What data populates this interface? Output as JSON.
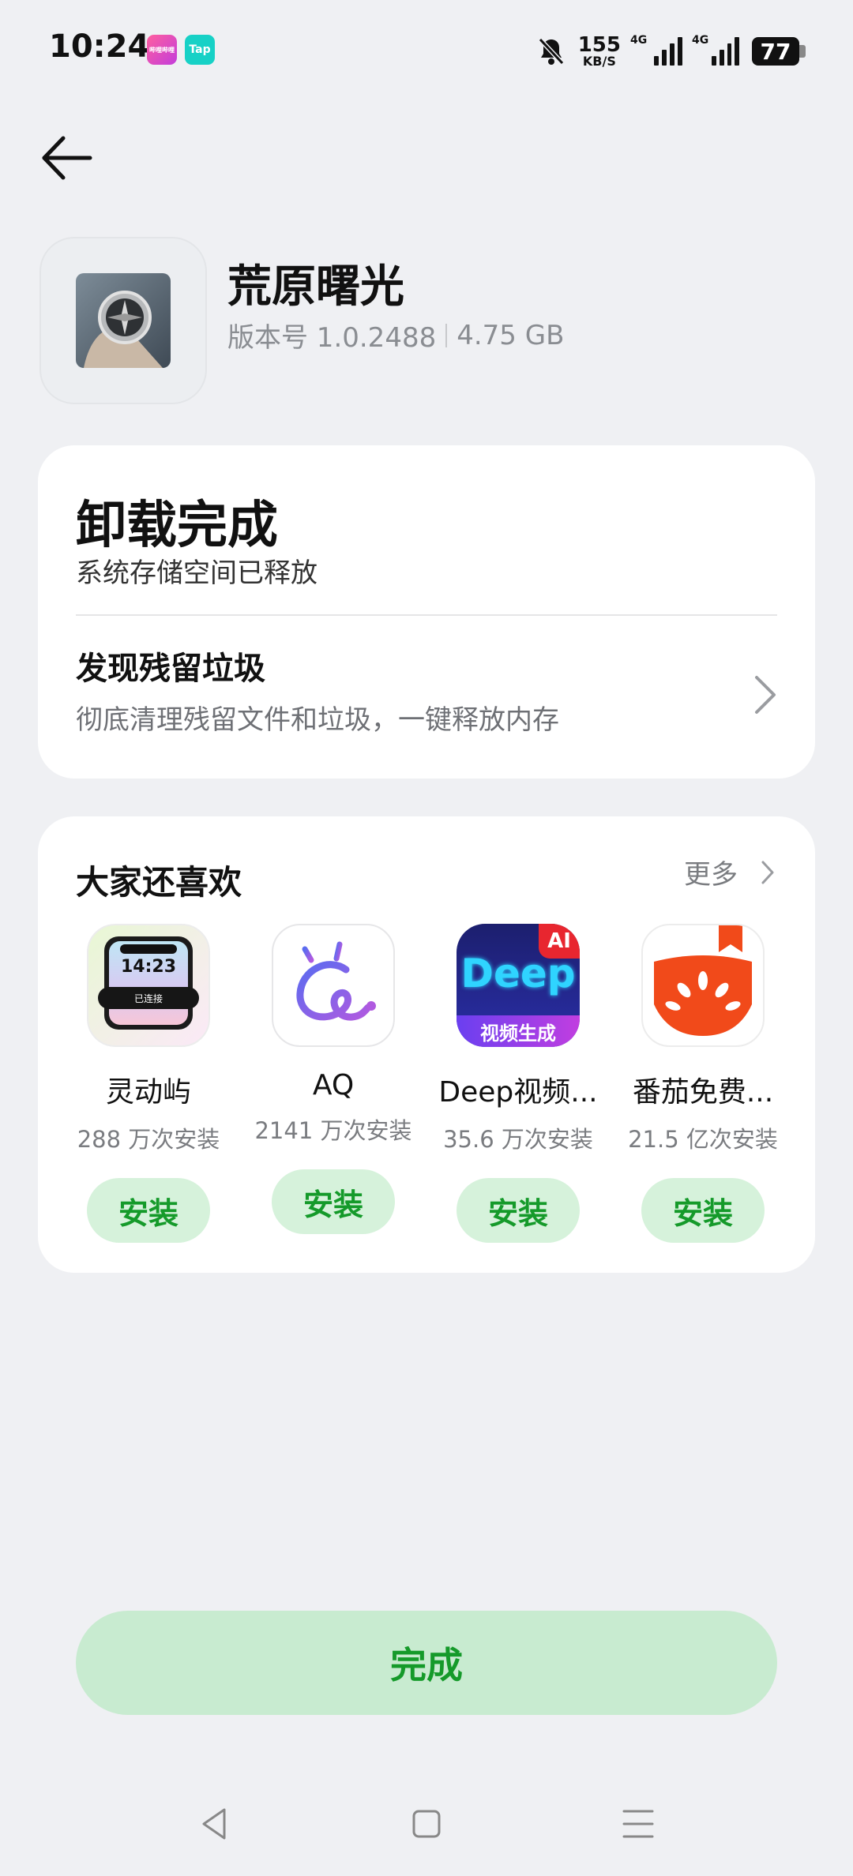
{
  "status_bar": {
    "time": "10:24",
    "notif_apps": [
      "bilibili-app-icon",
      "taptap-app-icon"
    ],
    "notif_labels": [
      "哔哩哔哩",
      "Tap"
    ],
    "net_speed": "155",
    "net_unit": "KB/S",
    "sim1": "4G",
    "sim2": "4G",
    "battery": "77"
  },
  "app": {
    "name": "荒原曙光",
    "version": "版本号 1.0.2488",
    "size": "4.75 GB"
  },
  "uninstall": {
    "title": "卸载完成",
    "subtitle": "系统存储空间已释放",
    "residue_title": "发现残留垃圾",
    "residue_subtitle": "彻底清理残留文件和垃圾，一键释放内存"
  },
  "recommend": {
    "title": "大家还喜欢",
    "more": "更多",
    "apps": [
      {
        "name": "灵动屿",
        "installs": "288 万次安装",
        "button": "安装",
        "icon_time": "14:23",
        "icon_label": "已连接"
      },
      {
        "name": "AQ",
        "installs": "2141 万次安装",
        "button": "安装"
      },
      {
        "name": "Deep视频...",
        "installs": "35.6 万次安装",
        "button": "安装",
        "icon_text": "Deep",
        "icon_badge": "AI",
        "icon_caption": "视频生成"
      },
      {
        "name": "番茄免费...",
        "installs": "21.5 亿次安装",
        "button": "安装"
      }
    ]
  },
  "done_label": "完成",
  "colors": {
    "accent_green": "#159a2a",
    "button_bg": "#d6f2db",
    "page_bg": "#eff0f3"
  }
}
